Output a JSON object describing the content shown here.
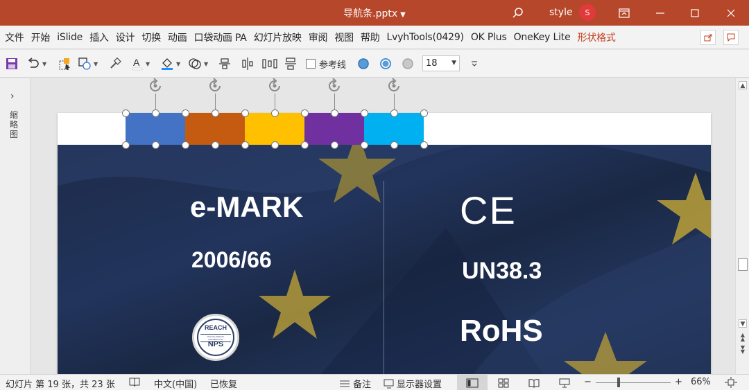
{
  "window": {
    "title": "导航条.pptx",
    "user": "style",
    "avatar_initial": "S"
  },
  "menu": {
    "items": [
      "文件",
      "开始",
      "iSlide",
      "插入",
      "设计",
      "切换",
      "动画",
      "口袋动画 PA",
      "幻灯片放映",
      "审阅",
      "视图",
      "帮助",
      "LvyhTools(0429)",
      "OK Plus",
      "OneKey Lite",
      "形状格式"
    ],
    "active_index": 15
  },
  "toolbar": {
    "ref_line_label": "参考线",
    "font_size": "18"
  },
  "left_pane": {
    "label": "缩略图"
  },
  "slide": {
    "nav_colors": [
      "#4472c4",
      "#c55a11",
      "#ffc000",
      "#7030a0",
      "#00b0f0"
    ],
    "left_title": "e-MARK",
    "left_code": "2006/66",
    "reach_top": "REACH",
    "reach_mid": "Directive REACH/ www.REACH.eu",
    "reach_bottom": "NPS",
    "ce_mark": "CE",
    "right_code": "UN38.3",
    "right_rohs": "RoHS"
  },
  "status": {
    "slide_info": "幻灯片 第 19 张，共 23 张",
    "language": "中文(中国)",
    "recovered": "已恢复",
    "notes": "备注",
    "display_settings": "显示器设置",
    "zoom_minus": "−",
    "zoom_plus": "+",
    "zoom": "66%"
  }
}
